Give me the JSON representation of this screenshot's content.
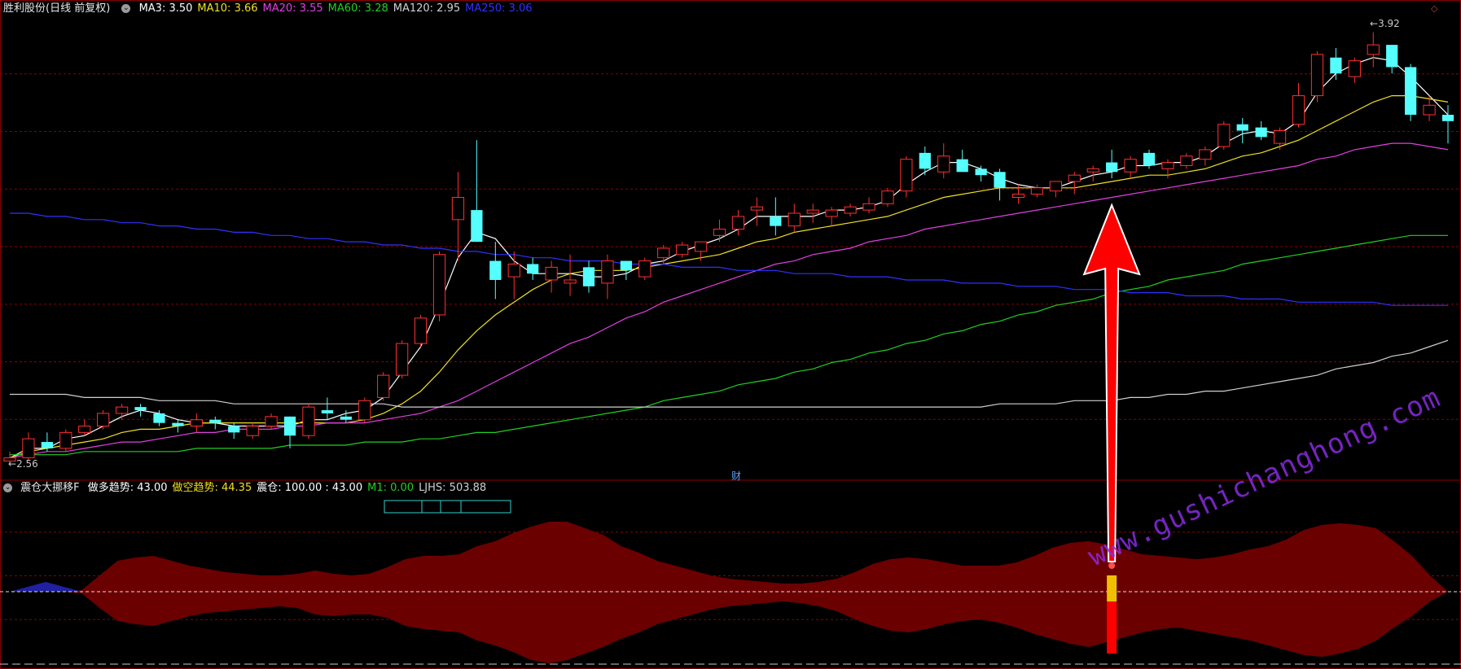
{
  "window": {
    "stock_title": "胜利股份(日线 前复权)",
    "ma_legend": [
      {
        "label": "MA3: 3.50",
        "color": "#ffffff"
      },
      {
        "label": "MA10: 3.66",
        "color": "#f0e020"
      },
      {
        "label": "MA20: 3.55",
        "color": "#e040e0"
      },
      {
        "label": "MA60: 3.28",
        "color": "#20d020"
      },
      {
        "label": "MA120: 2.95",
        "color": "#d0d0d0"
      },
      {
        "label": "MA250: 3.06",
        "color": "#3030ff"
      }
    ],
    "high_label": "3.92",
    "low_label": "2.56",
    "cai_label": "财",
    "corner_label": "◇",
    "indicator_title": "震仓大挪移F",
    "indicator_values": [
      {
        "label": "做多趋势: 43.00",
        "color": "#ffffff"
      },
      {
        "label": "做空趋势: 44.35",
        "color": "#f0e020"
      },
      {
        "label": "震仓: 100.00 : 43.00",
        "color": "#ffffff"
      },
      {
        "label": "M1: 0.00",
        "color": "#20d020"
      },
      {
        "label": "LJHS: 503.88",
        "color": "#d0d0d0"
      }
    ],
    "watermark": "www.gushichanghong.com"
  },
  "colors": {
    "up": "#ff3030",
    "down": "#55ffff",
    "grid": "#8b0000",
    "area": "#6b0000",
    "arrow": "#ff0000"
  },
  "chart_data": {
    "type": "candlestick",
    "ohlc": [
      [
        2.57,
        2.6,
        2.56,
        2.58
      ],
      [
        2.58,
        2.66,
        2.57,
        2.64
      ],
      [
        2.63,
        2.66,
        2.6,
        2.61
      ],
      [
        2.61,
        2.67,
        2.6,
        2.66
      ],
      [
        2.66,
        2.7,
        2.65,
        2.68
      ],
      [
        2.68,
        2.73,
        2.67,
        2.72
      ],
      [
        2.72,
        2.75,
        2.7,
        2.74
      ],
      [
        2.74,
        2.75,
        2.71,
        2.73
      ],
      [
        2.72,
        2.73,
        2.68,
        2.69
      ],
      [
        2.69,
        2.7,
        2.66,
        2.68
      ],
      [
        2.68,
        2.72,
        2.66,
        2.7
      ],
      [
        2.7,
        2.71,
        2.67,
        2.69
      ],
      [
        2.68,
        2.69,
        2.64,
        2.66
      ],
      [
        2.65,
        2.69,
        2.64,
        2.68
      ],
      [
        2.68,
        2.72,
        2.67,
        2.71
      ],
      [
        2.71,
        2.71,
        2.61,
        2.65
      ],
      [
        2.65,
        2.75,
        2.64,
        2.74
      ],
      [
        2.73,
        2.77,
        2.7,
        2.72
      ],
      [
        2.71,
        2.73,
        2.69,
        2.7
      ],
      [
        2.7,
        2.77,
        2.69,
        2.76
      ],
      [
        2.77,
        2.85,
        2.76,
        2.84
      ],
      [
        2.84,
        2.95,
        2.83,
        2.94
      ],
      [
        2.94,
        3.03,
        2.93,
        3.02
      ],
      [
        3.03,
        3.23,
        3.01,
        3.22
      ],
      [
        3.33,
        3.48,
        3.2,
        3.4
      ],
      [
        3.36,
        3.58,
        3.3,
        3.26
      ],
      [
        3.2,
        3.26,
        3.08,
        3.14
      ],
      [
        3.15,
        3.23,
        3.08,
        3.19
      ],
      [
        3.19,
        3.21,
        3.14,
        3.16
      ],
      [
        3.14,
        3.2,
        3.1,
        3.18
      ],
      [
        3.13,
        3.22,
        3.09,
        3.14
      ],
      [
        3.18,
        3.2,
        3.1,
        3.12
      ],
      [
        3.13,
        3.22,
        3.08,
        3.2
      ],
      [
        3.2,
        3.2,
        3.14,
        3.17
      ],
      [
        3.15,
        3.21,
        3.14,
        3.2
      ],
      [
        3.21,
        3.25,
        3.19,
        3.24
      ],
      [
        3.22,
        3.26,
        3.21,
        3.25
      ],
      [
        3.23,
        3.26,
        3.2,
        3.26
      ],
      [
        3.28,
        3.33,
        3.26,
        3.3
      ],
      [
        3.3,
        3.36,
        3.28,
        3.34
      ],
      [
        3.36,
        3.4,
        3.31,
        3.37
      ],
      [
        3.34,
        3.4,
        3.28,
        3.31
      ],
      [
        3.31,
        3.38,
        3.29,
        3.35
      ],
      [
        3.35,
        3.38,
        3.32,
        3.36
      ],
      [
        3.34,
        3.37,
        3.31,
        3.36
      ],
      [
        3.35,
        3.38,
        3.34,
        3.37
      ],
      [
        3.36,
        3.4,
        3.35,
        3.38
      ],
      [
        3.38,
        3.43,
        3.37,
        3.42
      ],
      [
        3.42,
        3.53,
        3.4,
        3.52
      ],
      [
        3.54,
        3.56,
        3.47,
        3.49
      ],
      [
        3.48,
        3.57,
        3.46,
        3.53
      ],
      [
        3.52,
        3.55,
        3.48,
        3.48
      ],
      [
        3.49,
        3.5,
        3.45,
        3.47
      ],
      [
        3.48,
        3.49,
        3.39,
        3.43
      ],
      [
        3.4,
        3.44,
        3.38,
        3.41
      ],
      [
        3.41,
        3.44,
        3.4,
        3.43
      ],
      [
        3.42,
        3.45,
        3.4,
        3.45
      ],
      [
        3.45,
        3.48,
        3.41,
        3.47
      ],
      [
        3.48,
        3.5,
        3.45,
        3.49
      ],
      [
        3.51,
        3.55,
        3.46,
        3.48
      ],
      [
        3.48,
        3.53,
        3.46,
        3.52
      ],
      [
        3.54,
        3.55,
        3.49,
        3.5
      ],
      [
        3.49,
        3.52,
        3.46,
        3.51
      ],
      [
        3.5,
        3.54,
        3.49,
        3.53
      ],
      [
        3.52,
        3.56,
        3.5,
        3.55
      ],
      [
        3.56,
        3.64,
        3.55,
        3.63
      ],
      [
        3.63,
        3.65,
        3.57,
        3.61
      ],
      [
        3.62,
        3.64,
        3.58,
        3.59
      ],
      [
        3.57,
        3.62,
        3.55,
        3.61
      ],
      [
        3.63,
        3.76,
        3.62,
        3.72
      ],
      [
        3.72,
        3.86,
        3.7,
        3.85
      ],
      [
        3.84,
        3.87,
        3.77,
        3.79
      ],
      [
        3.78,
        3.84,
        3.76,
        3.83
      ],
      [
        3.85,
        3.92,
        3.81,
        3.88
      ],
      [
        3.88,
        3.88,
        3.79,
        3.81
      ],
      [
        3.81,
        3.82,
        3.64,
        3.66
      ],
      [
        3.66,
        3.72,
        3.64,
        3.69
      ],
      [
        3.66,
        3.69,
        3.57,
        3.64
      ]
    ],
    "ma": {
      "MA3": [
        2.58,
        2.61,
        2.61,
        2.64,
        2.65,
        2.68,
        2.71,
        2.73,
        2.72,
        2.7,
        2.69,
        2.69,
        2.68,
        2.68,
        2.68,
        2.68,
        2.7,
        2.7,
        2.72,
        2.73,
        2.77,
        2.85,
        2.93,
        3.06,
        3.21,
        3.29,
        3.27,
        3.2,
        3.16,
        3.16,
        3.16,
        3.15,
        3.15,
        3.16,
        3.19,
        3.2,
        3.23,
        3.25,
        3.27,
        3.3,
        3.34,
        3.34,
        3.34,
        3.34,
        3.36,
        3.36,
        3.37,
        3.39,
        3.44,
        3.48,
        3.51,
        3.51,
        3.49,
        3.46,
        3.44,
        3.43,
        3.43,
        3.45,
        3.47,
        3.48,
        3.5,
        3.5,
        3.51,
        3.51,
        3.53,
        3.57,
        3.6,
        3.61,
        3.6,
        3.64,
        3.73,
        3.79,
        3.82,
        3.84,
        3.83,
        3.78,
        3.72,
        3.66
      ],
      "MA10": [
        2.58,
        2.6,
        2.61,
        2.62,
        2.63,
        2.64,
        2.66,
        2.67,
        2.67,
        2.68,
        2.69,
        2.69,
        2.69,
        2.69,
        2.69,
        2.69,
        2.69,
        2.69,
        2.69,
        2.7,
        2.72,
        2.75,
        2.79,
        2.85,
        2.92,
        2.98,
        3.03,
        3.07,
        3.11,
        3.14,
        3.16,
        3.17,
        3.17,
        3.17,
        3.18,
        3.19,
        3.2,
        3.21,
        3.22,
        3.24,
        3.26,
        3.27,
        3.29,
        3.3,
        3.31,
        3.32,
        3.33,
        3.34,
        3.36,
        3.38,
        3.4,
        3.41,
        3.42,
        3.43,
        3.43,
        3.43,
        3.43,
        3.43,
        3.44,
        3.45,
        3.46,
        3.47,
        3.47,
        3.48,
        3.49,
        3.51,
        3.53,
        3.54,
        3.56,
        3.58,
        3.61,
        3.64,
        3.67,
        3.7,
        3.72,
        3.72,
        3.71,
        3.7
      ],
      "MA20": [
        2.58,
        2.59,
        2.6,
        2.6,
        2.61,
        2.62,
        2.63,
        2.63,
        2.64,
        2.65,
        2.66,
        2.66,
        2.67,
        2.67,
        2.67,
        2.68,
        2.68,
        2.69,
        2.69,
        2.69,
        2.7,
        2.71,
        2.72,
        2.74,
        2.76,
        2.79,
        2.82,
        2.85,
        2.88,
        2.91,
        2.94,
        2.96,
        2.99,
        3.02,
        3.04,
        3.07,
        3.09,
        3.11,
        3.13,
        3.15,
        3.17,
        3.19,
        3.2,
        3.22,
        3.23,
        3.24,
        3.26,
        3.27,
        3.28,
        3.3,
        3.31,
        3.32,
        3.33,
        3.34,
        3.35,
        3.36,
        3.37,
        3.38,
        3.39,
        3.4,
        3.41,
        3.42,
        3.43,
        3.44,
        3.45,
        3.46,
        3.47,
        3.48,
        3.49,
        3.5,
        3.52,
        3.53,
        3.55,
        3.56,
        3.57,
        3.57,
        3.56,
        3.55
      ],
      "MA60": [
        2.59,
        2.59,
        2.59,
        2.59,
        2.6,
        2.6,
        2.6,
        2.6,
        2.6,
        2.6,
        2.61,
        2.61,
        2.61,
        2.61,
        2.61,
        2.62,
        2.62,
        2.62,
        2.62,
        2.63,
        2.63,
        2.63,
        2.64,
        2.64,
        2.65,
        2.66,
        2.66,
        2.67,
        2.68,
        2.69,
        2.7,
        2.71,
        2.72,
        2.73,
        2.74,
        2.76,
        2.77,
        2.78,
        2.79,
        2.81,
        2.82,
        2.83,
        2.85,
        2.86,
        2.88,
        2.89,
        2.91,
        2.92,
        2.94,
        2.95,
        2.97,
        2.98,
        3.0,
        3.01,
        3.03,
        3.04,
        3.06,
        3.07,
        3.08,
        3.1,
        3.11,
        3.12,
        3.14,
        3.15,
        3.16,
        3.17,
        3.19,
        3.2,
        3.21,
        3.22,
        3.23,
        3.24,
        3.25,
        3.26,
        3.27,
        3.28,
        3.28,
        3.28
      ],
      "MA120": [
        2.78,
        2.78,
        2.78,
        2.78,
        2.77,
        2.77,
        2.77,
        2.77,
        2.76,
        2.76,
        2.76,
        2.76,
        2.75,
        2.75,
        2.75,
        2.75,
        2.75,
        2.75,
        2.75,
        2.75,
        2.75,
        2.74,
        2.74,
        2.74,
        2.74,
        2.74,
        2.74,
        2.74,
        2.74,
        2.74,
        2.74,
        2.74,
        2.74,
        2.74,
        2.74,
        2.74,
        2.74,
        2.74,
        2.74,
        2.74,
        2.74,
        2.74,
        2.74,
        2.74,
        2.74,
        2.74,
        2.74,
        2.74,
        2.74,
        2.74,
        2.74,
        2.74,
        2.74,
        2.75,
        2.75,
        2.75,
        2.75,
        2.76,
        2.76,
        2.76,
        2.77,
        2.77,
        2.78,
        2.78,
        2.79,
        2.79,
        2.8,
        2.81,
        2.82,
        2.83,
        2.84,
        2.86,
        2.87,
        2.88,
        2.9,
        2.91,
        2.93,
        2.95
      ],
      "MA250": [
        3.35,
        3.35,
        3.34,
        3.34,
        3.33,
        3.33,
        3.32,
        3.32,
        3.31,
        3.31,
        3.3,
        3.3,
        3.29,
        3.29,
        3.28,
        3.28,
        3.27,
        3.27,
        3.26,
        3.26,
        3.25,
        3.25,
        3.24,
        3.24,
        3.23,
        3.23,
        3.22,
        3.22,
        3.21,
        3.21,
        3.2,
        3.2,
        3.2,
        3.19,
        3.19,
        3.19,
        3.18,
        3.18,
        3.18,
        3.17,
        3.17,
        3.17,
        3.16,
        3.16,
        3.16,
        3.15,
        3.15,
        3.15,
        3.14,
        3.14,
        3.14,
        3.13,
        3.13,
        3.13,
        3.12,
        3.12,
        3.12,
        3.11,
        3.11,
        3.11,
        3.1,
        3.1,
        3.1,
        3.09,
        3.09,
        3.09,
        3.08,
        3.08,
        3.08,
        3.07,
        3.07,
        3.07,
        3.07,
        3.07,
        3.06,
        3.06,
        3.06,
        3.06
      ]
    },
    "price_range": [
      2.52,
      3.97
    ],
    "indicator": {
      "upper": [
        0,
        0,
        0,
        0,
        2,
        20,
        38,
        42,
        44,
        38,
        32,
        28,
        24,
        22,
        20,
        20,
        22,
        26,
        22,
        20,
        22,
        30,
        40,
        44,
        44,
        46,
        56,
        62,
        72,
        80,
        86,
        86,
        78,
        70,
        56,
        48,
        38,
        32,
        26,
        20,
        16,
        14,
        12,
        10,
        10,
        12,
        16,
        24,
        34,
        40,
        42,
        40,
        36,
        32,
        32,
        32,
        36,
        44,
        54,
        60,
        62,
        58,
        52,
        46,
        44,
        42,
        40,
        42,
        46,
        52,
        56,
        64,
        76,
        82,
        84,
        82,
        78,
        62,
        44,
        20,
        0
      ],
      "lower": [
        0,
        0,
        0,
        0,
        2,
        20,
        36,
        40,
        42,
        36,
        30,
        26,
        24,
        22,
        20,
        18,
        20,
        28,
        30,
        28,
        28,
        32,
        42,
        46,
        48,
        50,
        60,
        66,
        74,
        84,
        88,
        84,
        76,
        68,
        58,
        50,
        40,
        34,
        28,
        22,
        18,
        16,
        14,
        12,
        14,
        18,
        24,
        34,
        42,
        48,
        50,
        46,
        40,
        36,
        34,
        38,
        44,
        52,
        58,
        64,
        68,
        62,
        56,
        50,
        46,
        44,
        48,
        52,
        56,
        60,
        66,
        72,
        78,
        80,
        76,
        70,
        60,
        44,
        30,
        12,
        0
      ],
      "blue_upper": [
        0,
        6,
        12,
        6,
        0
      ],
      "bar_index": 59,
      "bar_yellow_height": 32,
      "bar_red_height": 48,
      "zero_line": true
    }
  }
}
